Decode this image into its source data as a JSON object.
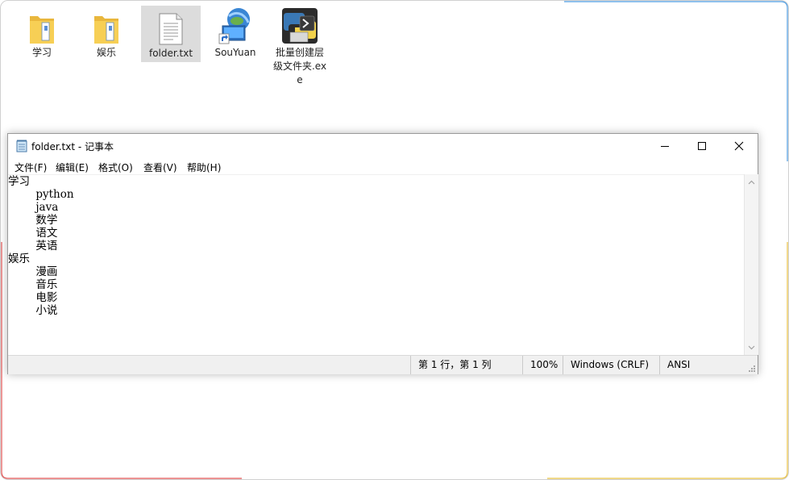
{
  "desktop": {
    "icons": [
      {
        "label": "学习",
        "icon": "folder-icon"
      },
      {
        "label": "娱乐",
        "icon": "folder-icon"
      },
      {
        "label": "folder.txt",
        "icon": "text-file-icon",
        "selected": true
      },
      {
        "label": "SouYuan",
        "icon": "globe-shortcut-icon"
      },
      {
        "label": "批量创建层级文件夹.exe",
        "icon": "python-exe-icon"
      }
    ]
  },
  "notepad": {
    "title": "folder.txt - 记事本",
    "menu": [
      "文件(F)",
      "编辑(E)",
      "格式(O)",
      "查看(V)",
      "帮助(H)"
    ],
    "content": "学习\n\tpython\n\tjava\n\t数学\n\t语文\n\t英语\n娱乐\n\t漫画\n\t音乐\n\t电影\n\t小说",
    "status": {
      "position": "第 1 行，第 1 列",
      "zoom": "100%",
      "line_ending": "Windows (CRLF)",
      "encoding": "ANSI"
    }
  },
  "colors": {
    "folder_yellow": "#f5c94a",
    "selection": "#dcdcdc",
    "statusbar": "#f0f0f0"
  }
}
